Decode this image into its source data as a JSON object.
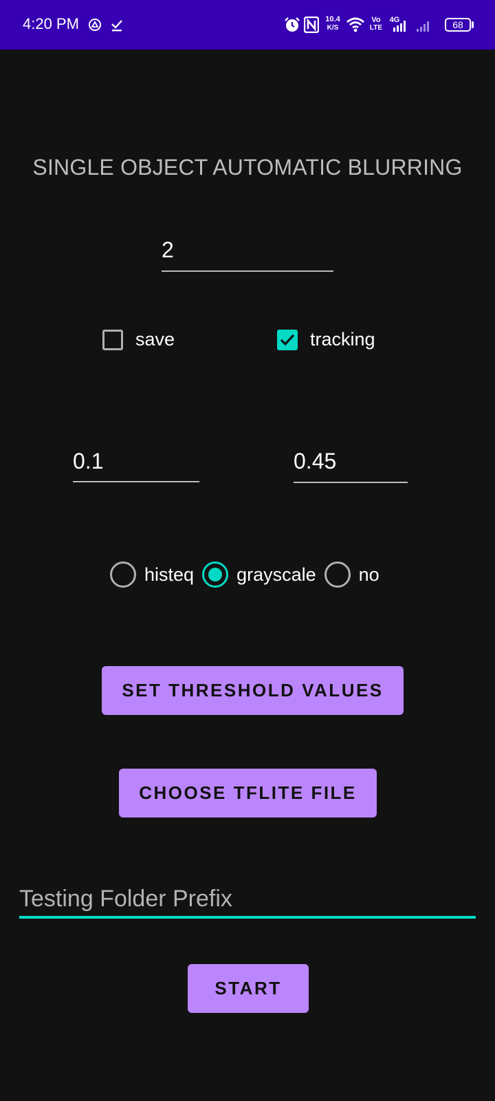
{
  "status_bar": {
    "time": "4:20 PM",
    "net_speed_value": "10.4",
    "net_speed_unit": "K/S",
    "volte_top": "Vo",
    "volte_bottom": "LTE",
    "network_type": "4G",
    "battery": "68",
    "icons": [
      "cast-icon",
      "download-done-icon",
      "alarm-icon",
      "nfc-icon",
      "wifi-icon",
      "signal-icon",
      "battery-icon"
    ]
  },
  "app": {
    "title": "SINGLE OBJECT AUTOMATIC BLURRING",
    "number_field": "2",
    "checkboxes": [
      {
        "label": "save",
        "checked": false
      },
      {
        "label": "tracking",
        "checked": true
      }
    ],
    "threshold_low": "0.1",
    "threshold_high": "0.45",
    "radios": [
      {
        "label": "histeq",
        "selected": false
      },
      {
        "label": "grayscale",
        "selected": true
      },
      {
        "label": "no",
        "selected": false
      }
    ],
    "set_threshold_label": "SET THRESHOLD VALUES",
    "choose_file_label": "CHOOSE TFLITE FILE",
    "prefix_placeholder": "Testing Folder Prefix",
    "start_label": "START"
  },
  "colors": {
    "status_bar": "#3700b3",
    "background": "#121212",
    "accent": "#03dac5",
    "button": "#bb86fc"
  }
}
